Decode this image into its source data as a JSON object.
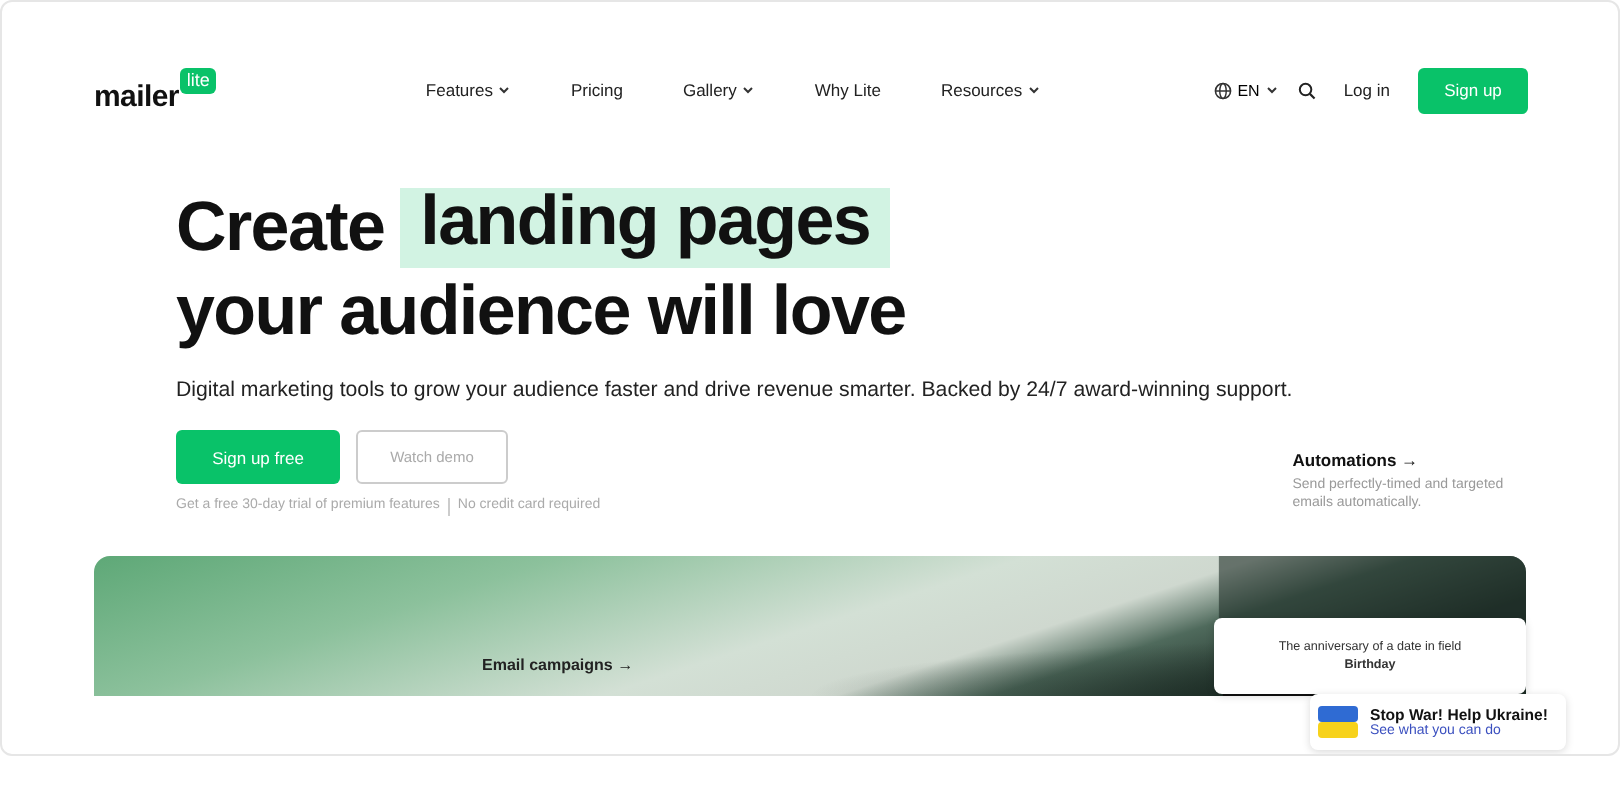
{
  "logo": {
    "word": "mailer",
    "badge": "lite"
  },
  "nav": [
    {
      "label": "Features",
      "dropdown": true
    },
    {
      "label": "Pricing",
      "dropdown": false
    },
    {
      "label": "Gallery",
      "dropdown": true
    },
    {
      "label": "Why Lite",
      "dropdown": false
    },
    {
      "label": "Resources",
      "dropdown": true
    }
  ],
  "language": "EN",
  "login": "Log in",
  "signup": "Sign up",
  "hero": {
    "headline_start": "Create",
    "highlight": "landing pages",
    "headline_end": "your audience will love",
    "subtitle": "Digital marketing tools to grow your audience faster and drive revenue smarter. Backed by 24/7 award-winning support.",
    "primary_button": "Sign up free",
    "secondary_button": "Watch demo",
    "notes": [
      "Get a free 30-day trial of premium features",
      "No credit card required"
    ]
  },
  "feature": {
    "title": "Automations →",
    "text": "Send perfectly-timed and targeted emails automatically."
  },
  "banner": {
    "title": "Email campaigns →",
    "popup": "The anniversary of a date in field **Birthday**"
  },
  "ukraine": {
    "title": "Stop War! Help Ukraine!",
    "link": "See what you can do"
  }
}
